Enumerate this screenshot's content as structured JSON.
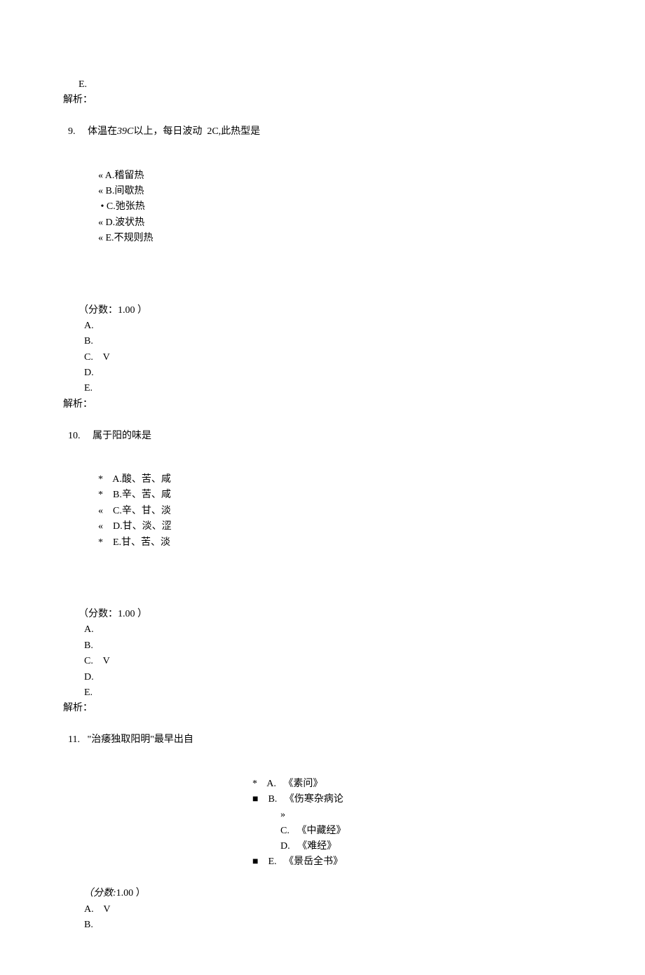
{
  "top": {
    "e": "E.",
    "jiexi": "解析："
  },
  "q9": {
    "num": "9.",
    "stem_a": "体温在",
    "stem_italic": "39C",
    "stem_b": "以上，每日波动  2C,此热型是",
    "opts": {
      "a": "« A.稽留热",
      "b": "« B.间歇热",
      "c": " • C.弛张热",
      "d": "« D.波状热",
      "e": "« E.不规则热"
    },
    "score": "（分数：1.00 ）",
    "ans": {
      "a": "A.",
      "b": "B.",
      "c": "C.    V",
      "d": "D.",
      "e": "E."
    },
    "jiexi": "解析："
  },
  "q10": {
    "num": "10.",
    "stem": "属于阳的味是",
    "opts": {
      "a": "*    A.酸、苦、咸",
      "b": "*    B.辛、苦、咸",
      "c": "«    C.辛、甘、淡",
      "d": "«    D.甘、淡、涩",
      "e": "*    E.甘、苦、淡"
    },
    "score": "（分数：1.00 ）",
    "ans": {
      "a": "A.",
      "b": "B.",
      "c": "C.    V",
      "d": "D.",
      "e": "E."
    },
    "jiexi": "解析："
  },
  "q11": {
    "num": "11.",
    "stem": "\"治痿独取阳明\"最早出自",
    "opts": {
      "a": "*    A.   《素问》",
      "b": "■    B.   《伤寒杂病论",
      "b2": "»",
      "c": "C.   《中藏经》",
      "d": "D.   《难经》",
      "e": "■    E.   《景岳全书》"
    },
    "score_italic": "（分数:",
    "score_rest": "1.00 ）",
    "ans": {
      "a": "A.    V",
      "b": "B."
    }
  }
}
